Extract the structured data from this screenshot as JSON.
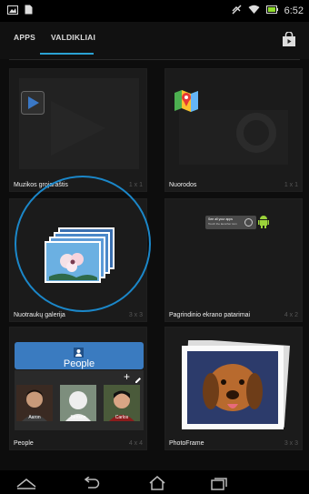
{
  "status_bar": {
    "time": "6:52",
    "icons": [
      "gallery-icon",
      "file-icon",
      "mute-icon",
      "wifi-icon",
      "battery-icon"
    ]
  },
  "tabs": {
    "apps_label": "APPS",
    "widgets_label": "VALDIKLIAI",
    "selected": "widgets"
  },
  "toolbar": {
    "store_icon": "store-bag-icon"
  },
  "widgets": [
    {
      "label": "Muzikos grojaraštis",
      "size": "1 x 1",
      "icon": "play-icon"
    },
    {
      "label": "Nuorodos",
      "size": "1 x 1",
      "icon": "maps-icon"
    },
    {
      "label": "Nuotraukų galerija",
      "size": "3 x 3",
      "icon": "photo-stack-icon"
    },
    {
      "label": "Pagrindinio ekrano patarimai",
      "size": "4 x 2",
      "icon": "tips-icon"
    },
    {
      "label": "People",
      "size": "4 x 4",
      "icon": "people-icon"
    },
    {
      "label": "PhotoFrame",
      "size": "3 x 3",
      "icon": "photo-frame-icon"
    }
  ],
  "people_widget": {
    "title": "People",
    "contacts": [
      "Aaron",
      "Benson",
      "Carlos"
    ]
  },
  "tips_widget": {
    "line1": "See all your apps",
    "line2": "Touch the launcher icon"
  },
  "colors": {
    "accent": "#2aa1d3",
    "people_header": "#3a7bc0",
    "background": "#0d0d0d"
  },
  "navbar": [
    "back-icon",
    "home-icon",
    "recents-icon"
  ]
}
